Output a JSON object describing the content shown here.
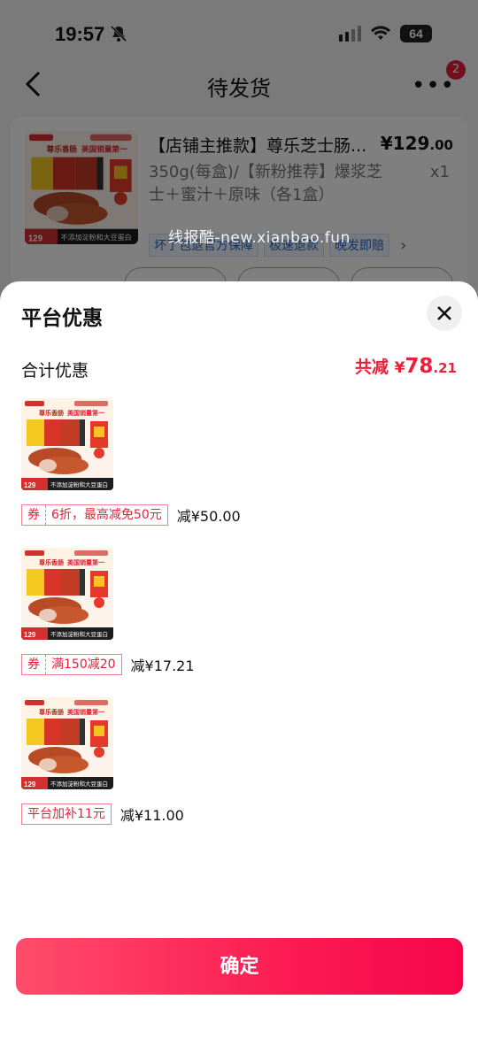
{
  "status_bar": {
    "time": "19:57",
    "battery": "64"
  },
  "nav": {
    "title": "待发货",
    "more_icon": "more-dots-icon",
    "badge": "2"
  },
  "order": {
    "title": "【店铺主推款】尊乐芝士肠...",
    "price_int": "¥129",
    "price_dec": ".00",
    "spec": "350g(每盒)/【新粉推荐】爆浆芝士＋蜜汁＋原味（各1盒）",
    "qty": "x1",
    "tags": [
      "坏了包退官方保障",
      "极速退款",
      "晚发即赔"
    ]
  },
  "watermark": "线报酷-new.xianbao.fun",
  "product_image": {
    "banner_text": "尊乐香肠",
    "banner_highlight": "美国销量第一",
    "price_badge": "129",
    "footer_text": "不添加淀粉和大豆蛋白"
  },
  "sheet": {
    "title": "平台优惠",
    "total_label": "合计优惠",
    "total_prefix": "共减",
    "total_symbol": "¥",
    "total_int": "78",
    "total_dec": ".21",
    "items": [
      {
        "coupon_prefix": "券",
        "coupon_text": "6折，最高减免50元",
        "saving": "减¥50.00"
      },
      {
        "coupon_prefix": "券",
        "coupon_text": "满150减20",
        "saving": "减¥17.21"
      },
      {
        "coupon_prefix": "",
        "coupon_text": "平台加补11元",
        "saving": "减¥11.00"
      }
    ],
    "confirm_label": "确定"
  },
  "colors": {
    "accent": "#e8203b",
    "button_start": "#ff4c6a",
    "button_end": "#f5064a"
  }
}
